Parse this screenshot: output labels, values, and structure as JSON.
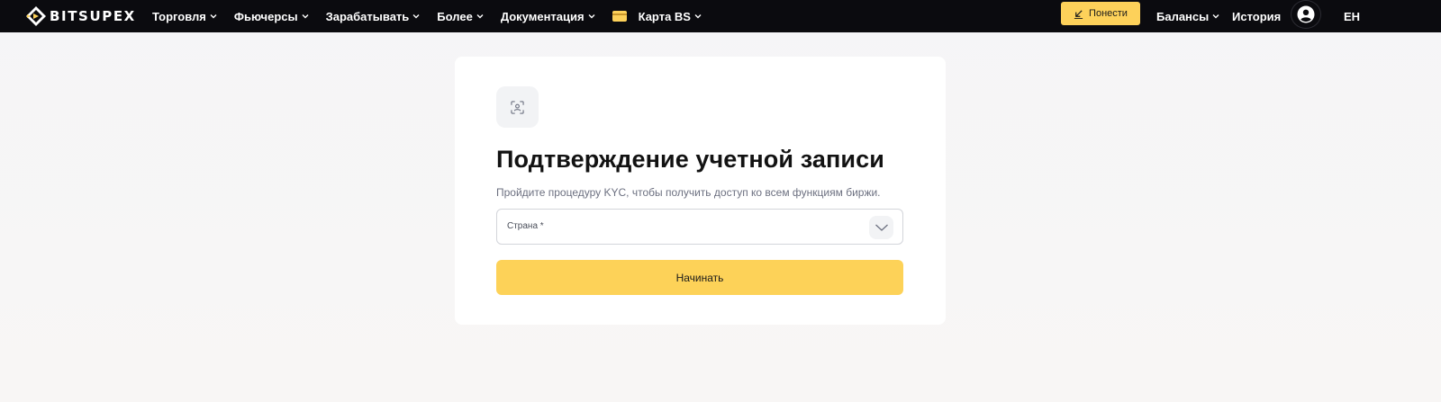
{
  "brand": {
    "name": "BITSUPEX",
    "accent": "#fdd15a"
  },
  "nav": {
    "items": [
      {
        "label": "Торговля",
        "icon": "chevron-down-icon"
      },
      {
        "label": "Фьючерсы",
        "icon": "chevron-down-icon"
      },
      {
        "label": "Зарабатывать",
        "icon": "chevron-down-icon"
      },
      {
        "label": "Более",
        "icon": "chevron-down-icon"
      },
      {
        "label": "Документация",
        "icon": "chevron-down-icon"
      },
      {
        "label": "Карта BS",
        "icon": "card-icon"
      }
    ],
    "deposit_label": "Понести",
    "balances_label": "Балансы",
    "history_label": "История",
    "language": "EH"
  },
  "kyc": {
    "icon": "face-scan-icon",
    "title": "Подтверждение учетной записи",
    "subtitle": "Пройдите процедуру KYC, чтобы получить доступ ко всем функциям биржи.",
    "country_placeholder": "Страна *",
    "start_label": "Начинать"
  }
}
